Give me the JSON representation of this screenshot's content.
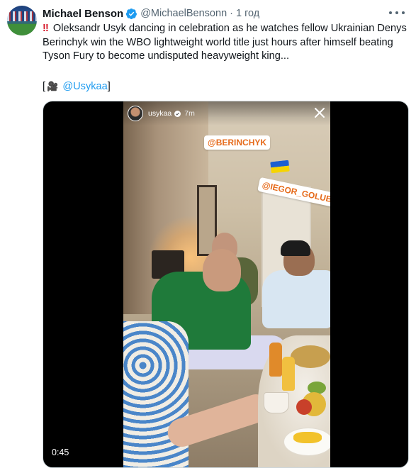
{
  "post": {
    "author_name": "Michael Benson",
    "handle": "@MichaelBensonn",
    "separator": "·",
    "time_ago": "1 год",
    "alert_icon": "‼",
    "text": "Oleksandr Usyk dancing in celebration as he watches fellow Ukrainian Denys Berinchyk win the WBO lightweight world title just hours after himself beating Tyson Fury to become undisputed heavyweight king...",
    "credit_open": "[",
    "credit_icon": "🎥",
    "credit_mention": "@Usykaa",
    "credit_close": "]"
  },
  "video": {
    "duration": "0:45",
    "story_username": "usykaa",
    "story_time": "7m",
    "sticker_1": "@BERINCHYK",
    "sticker_2": "@IEGOR_GOLUB"
  },
  "colors": {
    "link": "#1d9bf0",
    "verified": "#1d9bf0",
    "muted_text": "#536471",
    "sticker_text": "#e66a1a"
  },
  "icons": {
    "verified": "verified-badge-icon",
    "more": "more-options-icon",
    "close": "close-icon",
    "camera": "movie-camera-icon",
    "flag": "ukraine-flag-icon"
  }
}
